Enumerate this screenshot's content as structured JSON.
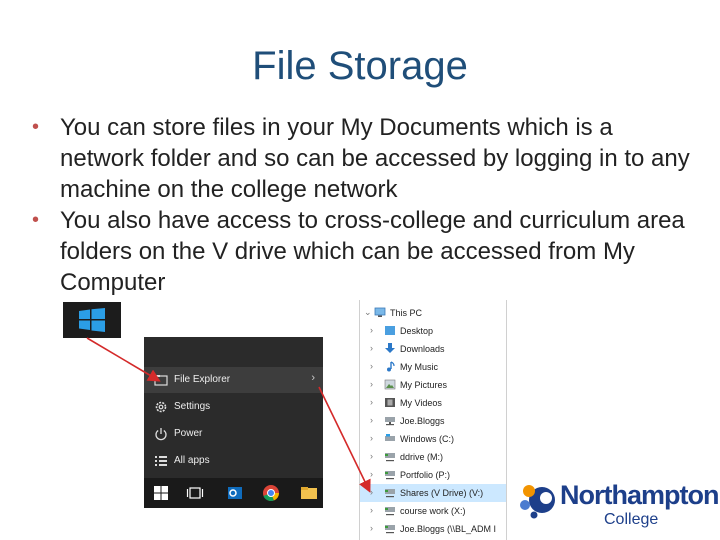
{
  "slide": {
    "title": "File Storage",
    "bullets": [
      "You can store files in your My Documents which is a network folder and so can be accessed by logging in to any machine on the college network",
      "You also have access to cross-college and curriculum area folders on the V drive which can be accessed from My Computer"
    ]
  },
  "start_menu": {
    "items": [
      {
        "label": "File Explorer",
        "icon": "folder-icon"
      },
      {
        "label": "Settings",
        "icon": "gear-icon"
      },
      {
        "label": "Power",
        "icon": "power-icon"
      },
      {
        "label": "All apps",
        "icon": "list-icon"
      }
    ],
    "chevron": "›"
  },
  "explorer": {
    "root": "This PC",
    "items": [
      {
        "label": "Desktop",
        "icon": "desktop-icon"
      },
      {
        "label": "Downloads",
        "icon": "download-icon"
      },
      {
        "label": "My Music",
        "icon": "music-icon"
      },
      {
        "label": "My Pictures",
        "icon": "pictures-icon"
      },
      {
        "label": "My Videos",
        "icon": "videos-icon"
      },
      {
        "label": "Joe.Bloggs",
        "icon": "network-drive-icon"
      },
      {
        "label": "Windows (C:)",
        "icon": "drive-icon"
      },
      {
        "label": "ddrive (M:)",
        "icon": "network-drive-icon"
      },
      {
        "label": "Portfolio (P:)",
        "icon": "network-drive-icon"
      },
      {
        "label": "Shares (V Drive) (V:)",
        "icon": "network-drive-icon"
      },
      {
        "label": "course work (X:)",
        "icon": "network-drive-icon"
      },
      {
        "label": "Joe.Bloggs    (\\\\BL_ADM I",
        "icon": "network-drive-icon"
      }
    ]
  },
  "logo": {
    "name": "Northampton",
    "sub": "College"
  },
  "colors": {
    "title": "#1f4e79",
    "bullet": "#c0504d",
    "arrow": "#d42a2a",
    "windows_blue": "#2b9ee6",
    "logo_blue": "#1d3f8a",
    "logo_orange": "#f29400"
  }
}
